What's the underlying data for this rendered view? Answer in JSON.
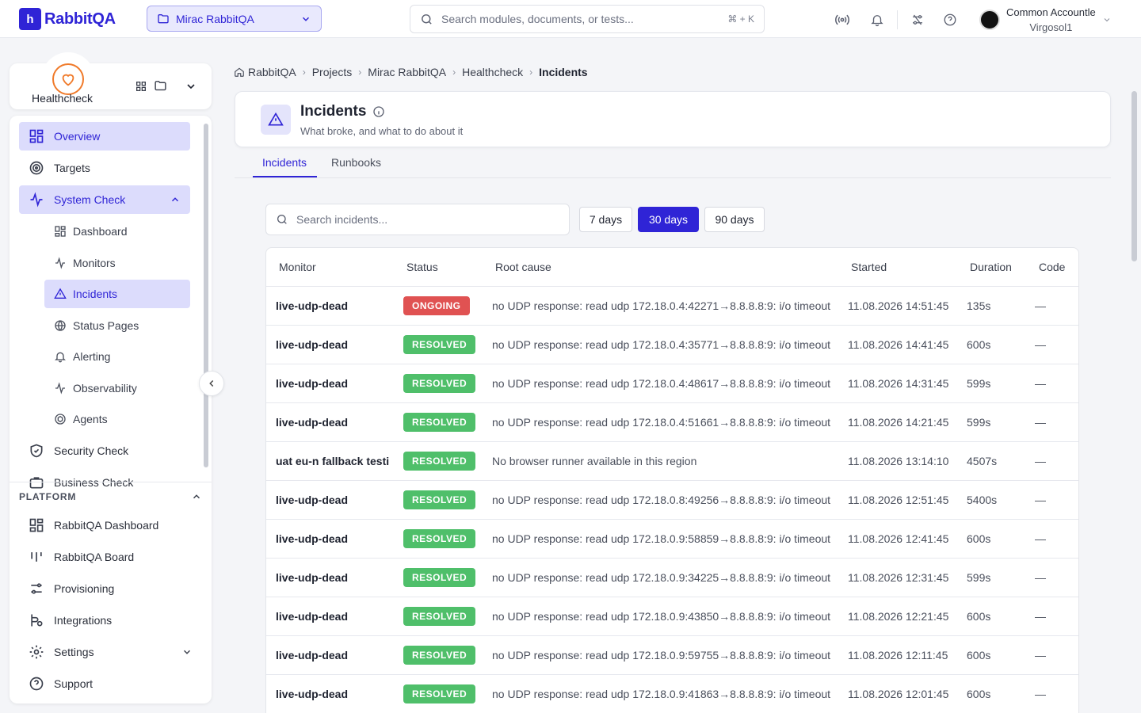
{
  "app": {
    "logo_text": "RabbitQA",
    "logo_mark": "h",
    "brand_color": "#2f24d6"
  },
  "topbar": {
    "project": "Mirac RabbitQA",
    "search_placeholder": "Search modules, documents, or tests...",
    "search_shortcut": "⌘ + K",
    "user_name": "Common Accountle",
    "user_org": "Virgosol1"
  },
  "module": {
    "name": "Healthcheck"
  },
  "sidebar": {
    "items": [
      {
        "label": "Overview"
      },
      {
        "label": "Targets"
      },
      {
        "label": "System Check"
      },
      {
        "label": "Dashboard"
      },
      {
        "label": "Monitors"
      },
      {
        "label": "Incidents"
      },
      {
        "label": "Status Pages"
      },
      {
        "label": "Alerting"
      },
      {
        "label": "Observability"
      },
      {
        "label": "Agents"
      },
      {
        "label": "Security Check"
      },
      {
        "label": "Business Check"
      }
    ],
    "platform_heading": "PLATFORM",
    "platform_items": [
      {
        "label": "RabbitQA Dashboard"
      },
      {
        "label": "RabbitQA Board"
      },
      {
        "label": "Provisioning"
      },
      {
        "label": "Integrations"
      },
      {
        "label": "Settings"
      },
      {
        "label": "Support"
      }
    ]
  },
  "breadcrumb": [
    "RabbitQA",
    "Projects",
    "Mirac RabbitQA",
    "Healthcheck",
    "Incidents"
  ],
  "page": {
    "title": "Incidents",
    "subtitle": "What broke, and what to do about it"
  },
  "tabs": [
    "Incidents",
    "Runbooks"
  ],
  "filters": {
    "search_placeholder": "Search incidents...",
    "ranges": [
      "7 days",
      "30 days",
      "90 days"
    ],
    "selected_range": "30 days"
  },
  "table": {
    "columns": [
      "Monitor",
      "Status",
      "Root cause",
      "Started",
      "Duration",
      "Code"
    ],
    "rows": [
      {
        "monitor": "live-udp-dead",
        "status": "ONGOING",
        "cause": "no UDP response: read udp 172.18.0.4:42271→8.8.8.8:9: i/o timeout",
        "started": "11.08.2026 14:51:45",
        "duration": "135s",
        "code": "—"
      },
      {
        "monitor": "live-udp-dead",
        "status": "RESOLVED",
        "cause": "no UDP response: read udp 172.18.0.4:35771→8.8.8.8:9: i/o timeout",
        "started": "11.08.2026 14:41:45",
        "duration": "600s",
        "code": "—"
      },
      {
        "monitor": "live-udp-dead",
        "status": "RESOLVED",
        "cause": "no UDP response: read udp 172.18.0.4:48617→8.8.8.8:9: i/o timeout",
        "started": "11.08.2026 14:31:45",
        "duration": "599s",
        "code": "—"
      },
      {
        "monitor": "live-udp-dead",
        "status": "RESOLVED",
        "cause": "no UDP response: read udp 172.18.0.4:51661→8.8.8.8:9: i/o timeout",
        "started": "11.08.2026 14:21:45",
        "duration": "599s",
        "code": "—"
      },
      {
        "monitor": "uat eu-n fallback testi",
        "status": "RESOLVED",
        "cause": "No browser runner available in this region",
        "started": "11.08.2026 13:14:10",
        "duration": "4507s",
        "code": "—"
      },
      {
        "monitor": "live-udp-dead",
        "status": "RESOLVED",
        "cause": "no UDP response: read udp 172.18.0.8:49256→8.8.8.8:9: i/o timeout",
        "started": "11.08.2026 12:51:45",
        "duration": "5400s",
        "code": "—"
      },
      {
        "monitor": "live-udp-dead",
        "status": "RESOLVED",
        "cause": "no UDP response: read udp 172.18.0.9:58859→8.8.8.8:9: i/o timeout",
        "started": "11.08.2026 12:41:45",
        "duration": "600s",
        "code": "—"
      },
      {
        "monitor": "live-udp-dead",
        "status": "RESOLVED",
        "cause": "no UDP response: read udp 172.18.0.9:34225→8.8.8.8:9: i/o timeout",
        "started": "11.08.2026 12:31:45",
        "duration": "599s",
        "code": "—"
      },
      {
        "monitor": "live-udp-dead",
        "status": "RESOLVED",
        "cause": "no UDP response: read udp 172.18.0.9:43850→8.8.8.8:9: i/o timeout",
        "started": "11.08.2026 12:21:45",
        "duration": "600s",
        "code": "—"
      },
      {
        "monitor": "live-udp-dead",
        "status": "RESOLVED",
        "cause": "no UDP response: read udp 172.18.0.9:59755→8.8.8.8:9: i/o timeout",
        "started": "11.08.2026 12:11:45",
        "duration": "600s",
        "code": "—"
      },
      {
        "monitor": "live-udp-dead",
        "status": "RESOLVED",
        "cause": "no UDP response: read udp 172.18.0.9:41863→8.8.8.8:9: i/o timeout",
        "started": "11.08.2026 12:01:45",
        "duration": "600s",
        "code": "—"
      }
    ]
  },
  "colors": {
    "ongoing": "#e05252",
    "resolved": "#4fbf6a",
    "accent": "#2f24d6",
    "module_accent": "#f07a2a"
  }
}
